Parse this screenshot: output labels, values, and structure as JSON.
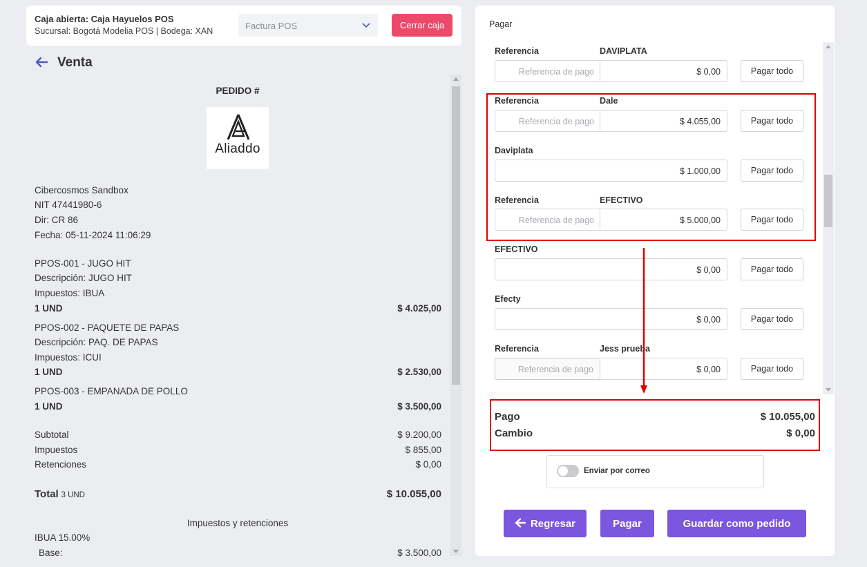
{
  "cash": {
    "open_label": "Caja abierta: Caja Hayuelos POS",
    "branch_label": "Sucursal: Bogotá Modelia POS | Bodega: XAN",
    "document_type": "Factura POS",
    "close_button": "Cerrar caja"
  },
  "page": {
    "title": "Venta"
  },
  "receipt": {
    "pedido": "PEDIDO #",
    "logo_text": "Aliaddo",
    "company": "Cibercosmos Sandbox",
    "nit": "NIT 47441980-6",
    "address": "Dir: CR 86",
    "date": "Fecha: 05-11-2024 11:06:29",
    "items": [
      {
        "name": "PPOS-001 - JUGO HIT",
        "description": "Descripción: JUGO HIT",
        "taxes": "Impuestos: IBUA",
        "qty": "1 UND",
        "total": "$ 4.025,00"
      },
      {
        "name": "PPOS-002 - PAQUETE DE PAPAS",
        "description": "Descripción: PAQ. DE PAPAS",
        "taxes": "Impuestos: ICUI",
        "qty": "1 UND",
        "total": "$ 2.530,00"
      },
      {
        "name": "PPOS-003 - EMPANADA DE POLLO",
        "qty": "1 UND",
        "total": "$ 3.500,00"
      }
    ],
    "subtotal_label": "Subtotal",
    "subtotal": "$ 9.200,00",
    "taxes_label": "Impuestos",
    "taxes": "$ 855,00",
    "retentions_label": "Retenciones",
    "retentions": "$ 0,00",
    "total_label": "Total",
    "total_units": "3 UND",
    "total": "$ 10.055,00",
    "tax_section_title": "Impuestos y retenciones",
    "tax_line": "IBUA 15.00%",
    "base_label": "Base:",
    "base_value": "$ 3.500,00"
  },
  "payment": {
    "title": "Pagar",
    "ref_label": "Referencia",
    "ref_placeholder": "Referencia de pago",
    "pay_all": "Pagar todo",
    "methods": [
      {
        "name": "DAVIPLATA",
        "amount": "$ 0,00"
      },
      {
        "name": "Dale",
        "amount": "$ 4.055,00"
      },
      {
        "name": "Daviplata",
        "amount": "$ 1.000,00"
      },
      {
        "name": "EFECTIVO",
        "amount": "$ 5.000,00"
      },
      {
        "name": "EFECTIVO",
        "amount": "$ 0,00"
      },
      {
        "name": "Efecty",
        "amount": "$ 0,00"
      },
      {
        "name": "Jess prueba",
        "amount": "$ 0,00"
      }
    ],
    "pago_label": "Pago",
    "pago_value": "$ 10.055,00",
    "cambio_label": "Cambio",
    "cambio_value": "$ 0,00",
    "email_toggle_label": "Enviar por correo",
    "email_toggle_on": false,
    "back_button": "Regresar",
    "pay_button": "Pagar",
    "save_order_button": "Guardar como pedido"
  },
  "colors": {
    "accent": "#7b56de",
    "close": "#ec4a6a",
    "highlight": "#e00000"
  }
}
